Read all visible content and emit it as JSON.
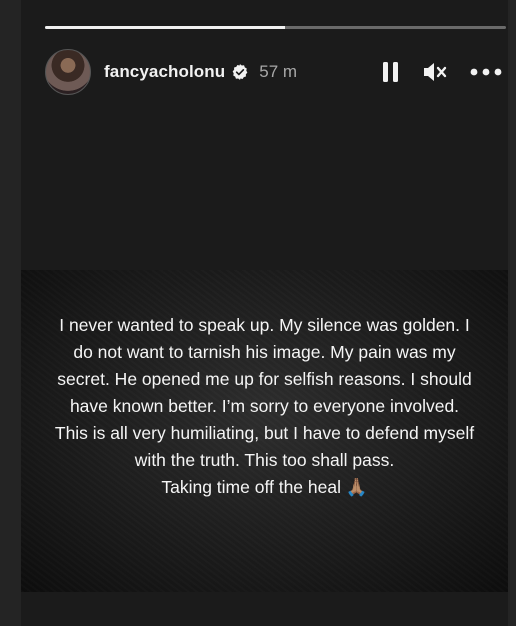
{
  "story": {
    "progress_fraction": 0.52,
    "username": "fancyacholonu",
    "verified": true,
    "time_ago": "57 m",
    "icons": [
      "verified-badge-icon",
      "pause-icon",
      "muted-speaker-icon",
      "more-options-icon"
    ]
  },
  "media": {
    "lines": [
      "I never wanted to speak up. My silence was golden. I",
      "do not want to tarnish his image. My pain was my",
      "secret. He opened me up for selfish reasons. I should",
      "have known better. I’m sorry to everyone involved.",
      "This is all very humiliating, but I have to defend myself",
      "with the truth. This too shall pass.",
      "Taking time off the heal 🙏🏽"
    ]
  },
  "colors": {
    "background": "#242424",
    "story_bg": "#1b1b1b",
    "text": "#f2f2f2",
    "muted": "#a8a8a8"
  }
}
